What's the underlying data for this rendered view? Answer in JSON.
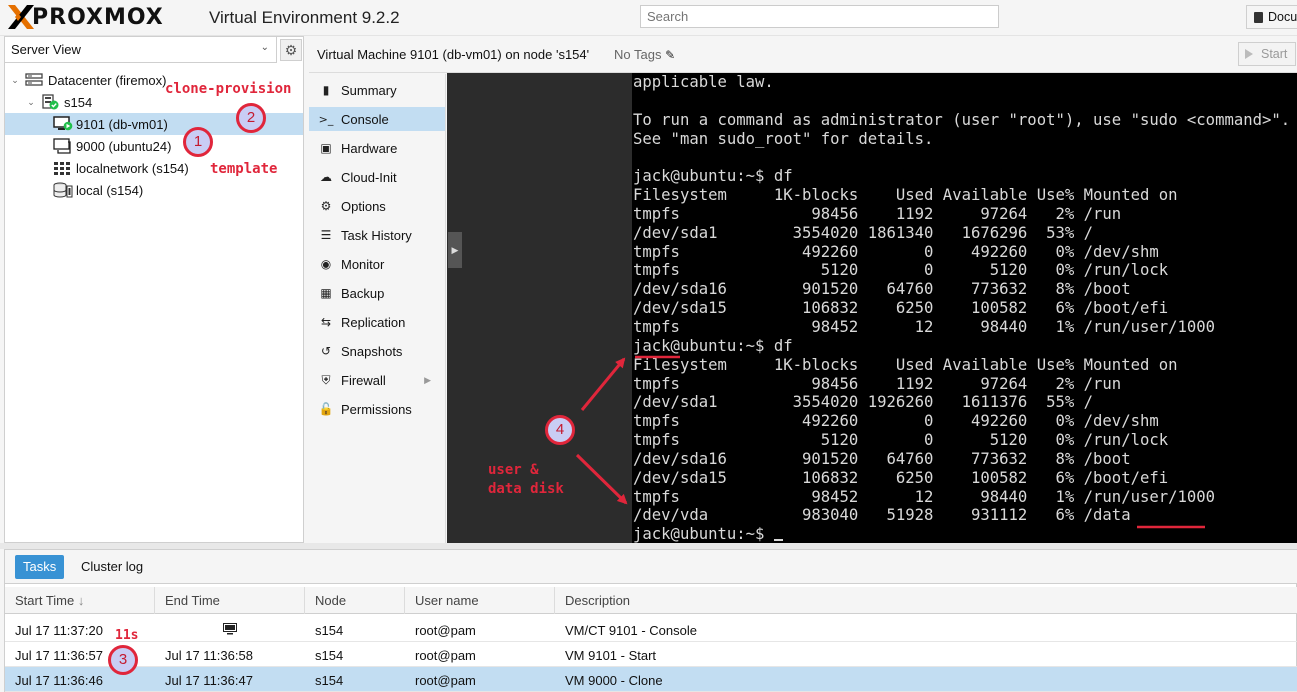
{
  "header": {
    "brand": "PROXMOX",
    "product": "Virtual Environment 9.2.2",
    "search_placeholder": "Search",
    "docs_label": "Docu"
  },
  "left_panel": {
    "view_selector": "Server View",
    "tree": [
      {
        "label": "Datacenter (firemox)",
        "icon": "datacenter-icon"
      },
      {
        "label": "s154",
        "icon": "node-online-icon"
      },
      {
        "label": "9101 (db-vm01)",
        "icon": "vm-running-icon",
        "selected": true
      },
      {
        "label": "9000 (ubuntu24)",
        "icon": "template-icon"
      },
      {
        "label": "localnetwork (s154)",
        "icon": "sdn-grid-icon"
      },
      {
        "label": "local (s154)",
        "icon": "storage-icon"
      }
    ]
  },
  "vm_header": {
    "title": "Virtual Machine 9101 (db-vm01) on node 's154'",
    "tags": "No Tags",
    "start_label": "Start"
  },
  "vm_nav": [
    {
      "label": "Summary",
      "icon": "book-icon"
    },
    {
      "label": "Console",
      "icon": "terminal-icon",
      "selected": true
    },
    {
      "label": "Hardware",
      "icon": "monitor-icon"
    },
    {
      "label": "Cloud-Init",
      "icon": "cloud-icon"
    },
    {
      "label": "Options",
      "icon": "gear-icon"
    },
    {
      "label": "Task History",
      "icon": "list-icon"
    },
    {
      "label": "Monitor",
      "icon": "eye-icon"
    },
    {
      "label": "Backup",
      "icon": "floppy-icon"
    },
    {
      "label": "Replication",
      "icon": "retweet-icon"
    },
    {
      "label": "Snapshots",
      "icon": "history-icon"
    },
    {
      "label": "Firewall",
      "icon": "shield-icon",
      "has_submenu": true
    },
    {
      "label": "Permissions",
      "icon": "unlock-icon"
    }
  ],
  "terminal": {
    "lines": [
      "applicable law.",
      "",
      "To run a command as administrator (user \"root\"), use \"sudo <command>\".",
      "See \"man sudo_root\" for details.",
      "",
      "jack@ubuntu:~$ df",
      "Filesystem     1K-blocks    Used Available Use% Mounted on",
      "tmpfs              98456    1192     97264   2% /run",
      "/dev/sda1        3554020 1861340   1676296  53% /",
      "tmpfs             492260       0    492260   0% /dev/shm",
      "tmpfs               5120       0      5120   0% /run/lock",
      "/dev/sda16        901520   64760    773632   8% /boot",
      "/dev/sda15        106832    6250    100582   6% /boot/efi",
      "tmpfs              98452      12     98440   1% /run/user/1000",
      "jack@ubuntu:~$ df",
      "Filesystem     1K-blocks    Used Available Use% Mounted on",
      "tmpfs              98456    1192     97264   2% /run",
      "/dev/sda1        3554020 1926260   1611376  55% /",
      "tmpfs             492260       0    492260   0% /dev/shm",
      "tmpfs               5120       0      5120   0% /run/lock",
      "/dev/sda16        901520   64760    773632   8% /boot",
      "/dev/sda15        106832    6250    100582   6% /boot/efi",
      "tmpfs              98452      12     98440   1% /run/user/1000",
      "/dev/vda          983040   51928    931112   6% /data",
      "jack@ubuntu:~$ "
    ]
  },
  "tasks": {
    "tabs": [
      "Tasks",
      "Cluster log"
    ],
    "columns": [
      "Start Time",
      "End Time",
      "Node",
      "User name",
      "Description"
    ],
    "rows": [
      {
        "start": "Jul 17 11:37:20",
        "end": "",
        "end_icon": "console-icon",
        "node": "s154",
        "user": "root@pam",
        "desc": "VM/CT 9101 - Console"
      },
      {
        "start": "Jul 17 11:36:57",
        "end": "Jul 17 11:36:58",
        "node": "s154",
        "user": "root@pam",
        "desc": "VM 9101 - Start"
      },
      {
        "start": "Jul 17 11:36:46",
        "end": "Jul 17 11:36:47",
        "node": "s154",
        "user": "root@pam",
        "desc": "VM 9000 - Clone",
        "selected": true
      }
    ]
  },
  "annotations": {
    "clone_provision": "clone-provision",
    "template": "template",
    "duration": "11s",
    "user_data_disk": "user &\ndata disk",
    "badges": [
      "1",
      "2",
      "3",
      "4"
    ],
    "color": "#e0263b"
  },
  "colors": {
    "selection": "#c2ddf2",
    "tab_active": "#3892d4",
    "brand_orange": "#e57000",
    "status_green": "#21bf4b"
  }
}
